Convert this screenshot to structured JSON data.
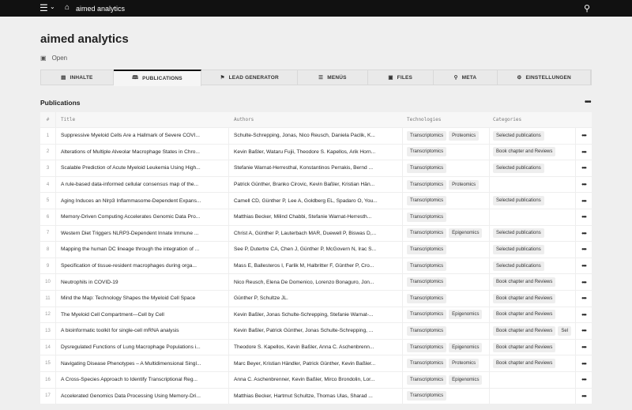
{
  "topbar": {
    "app_title": "aimed analytics"
  },
  "page": {
    "title": "aimed analytics",
    "status": "Open",
    "section_title": "Publications"
  },
  "tabs": [
    {
      "label": "INHALTE",
      "icon": "▤"
    },
    {
      "label": "PUBLICATIONS",
      "icon": "🕮"
    },
    {
      "label": "LEAD GENERATOR",
      "icon": "⚑"
    },
    {
      "label": "MENÜS",
      "icon": "☰"
    },
    {
      "label": "FILES",
      "icon": "▣"
    },
    {
      "label": "META",
      "icon": "⚲"
    },
    {
      "label": "EINSTELLUNGEN",
      "icon": "⚙"
    }
  ],
  "table": {
    "headers": [
      "#",
      "Title",
      "Authors",
      "Technologies",
      "Categories"
    ],
    "rows": [
      {
        "n": "1",
        "title": "Suppressive Myeloid Cells Are a Hallmark of Severe COVI...",
        "authors": "Schulte-Schrepping, Jonas, Nico Reusch, Daniela Paclik, K...",
        "tech": [
          "Transcriptomics",
          "Proteomics"
        ],
        "cat": [
          "Selected publications"
        ]
      },
      {
        "n": "2",
        "title": "Alterations of Multiple Alveolar Macrophage States in Chro...",
        "authors": "Kevin Baßler, Wataru Fujii, Theodore S. Kapellos, Arik Horn...",
        "tech": [
          "Transcriptomics"
        ],
        "cat": [
          "Book chapter and Reviews"
        ]
      },
      {
        "n": "3",
        "title": "Scalable Prediction of Acute Myeloid Leukemia Using High...",
        "authors": "Stefanie Warnat-Herresthal, Konstantinos Perrakis, Bernd ...",
        "tech": [
          "Transcriptomics"
        ],
        "cat": [
          "Selected publications"
        ]
      },
      {
        "n": "4",
        "title": "A rule-based data-informed cellular consensus map of the...",
        "authors": "Patrick Günther, Branko Cirovic, Kevin Baßler, Kristian Hän...",
        "tech": [
          "Transcriptomics",
          "Proteomics"
        ],
        "cat": []
      },
      {
        "n": "5",
        "title": "Aging Induces an Nlrp3 Inflammasome-Dependent Expans...",
        "authors": "Camell CD, Günther P, Lee A, Goldberg EL, Spadaro O, You...",
        "tech": [
          "Transcriptomics"
        ],
        "cat": [
          "Selected publications"
        ]
      },
      {
        "n": "6",
        "title": "Memory-Driven Computing Accelerates Genomic Data Pro...",
        "authors": "Matthias Becker, Milind Chabbi, Stefanie Warnat-Herresth...",
        "tech": [
          "Transcriptomics"
        ],
        "cat": []
      },
      {
        "n": "7",
        "title": "Western Diet Triggers NLRP3-Dependent Innate Immune ...",
        "authors": "Christ A, Günther P, Lauterbach MAR, Duewell P, Biswas D,...",
        "tech": [
          "Transcriptomics",
          "Epigenomics"
        ],
        "cat": [
          "Selected publications"
        ]
      },
      {
        "n": "8",
        "title": "Mapping the human DC lineage through the integration of ...",
        "authors": "See P, Dutertre CA, Chen J, Günther P, McGovern N, Irac S...",
        "tech": [
          "Transcriptomics"
        ],
        "cat": [
          "Selected publications"
        ]
      },
      {
        "n": "9",
        "title": "Specification of tissue-resident macrophages during orga...",
        "authors": "Mass E, Ballesteros I, Farlik M, Halbritter F, Günther P, Cro...",
        "tech": [
          "Transcriptomics"
        ],
        "cat": [
          "Selected publications"
        ]
      },
      {
        "n": "10",
        "title": "Neutrophils in COVID-19",
        "authors": "Nico Reusch, Elena De Domenico, Lorenzo Bonaguro, Jon...",
        "tech": [
          "Transcriptomics"
        ],
        "cat": [
          "Book chapter and Reviews"
        ]
      },
      {
        "n": "11",
        "title": "Mind the Map: Technology Shapes the Myeloid Cell Space",
        "authors": "Günther P, Schultze JL.",
        "tech": [
          "Transcriptomics"
        ],
        "cat": [
          "Book chapter and Reviews"
        ]
      },
      {
        "n": "12",
        "title": "The Myeloid Cell Compartment—Cell by Cell",
        "authors": "Kevin Baßler, Jonas Schulte-Schrepping, Stefanie Warnat-...",
        "tech": [
          "Transcriptomics",
          "Epigenomics"
        ],
        "cat": [
          "Book chapter and Reviews"
        ]
      },
      {
        "n": "13",
        "title": "A bioinformatic toolkit for single-cell mRNA analysis",
        "authors": "Kevin Baßler, Patrick Günther, Jonas Schulte-Schrepping, ...",
        "tech": [
          "Transcriptomics"
        ],
        "cat": [
          "Book chapter and Reviews",
          "Sel"
        ]
      },
      {
        "n": "14",
        "title": "Dysregulated Functions of Lung Macrophage Populations i...",
        "authors": "Theodore S. Kapellos, Kevin Baßler, Anna C. Aschenbrenn...",
        "tech": [
          "Transcriptomics",
          "Epigenomics"
        ],
        "cat": [
          "Book chapter and Reviews"
        ]
      },
      {
        "n": "15",
        "title": "Navigating Disease Phenotypes – A Multidimensional Singl...",
        "authors": "Marc Beyer, Kristian Händler, Patrick Günther, Kevin Baßler...",
        "tech": [
          "Transcriptomics",
          "Proteomics"
        ],
        "cat": [
          "Book chapter and Reviews"
        ]
      },
      {
        "n": "16",
        "title": "A Cross-Species Approach to Identify Transcriptional Reg...",
        "authors": "Anna C. Aschenbrenner, Kevin Baßler, Mirco Brondolin, Lor...",
        "tech": [
          "Transcriptomics",
          "Epigenomics"
        ],
        "cat": []
      },
      {
        "n": "17",
        "title": "Accelerated Genomics Data Processing Using Memory-Dri...",
        "authors": "Matthias Becker, Hartmut Schultze, Thomas Ulas, Sharad ...",
        "tech": [
          "Transcriptomics"
        ],
        "cat": []
      }
    ]
  }
}
